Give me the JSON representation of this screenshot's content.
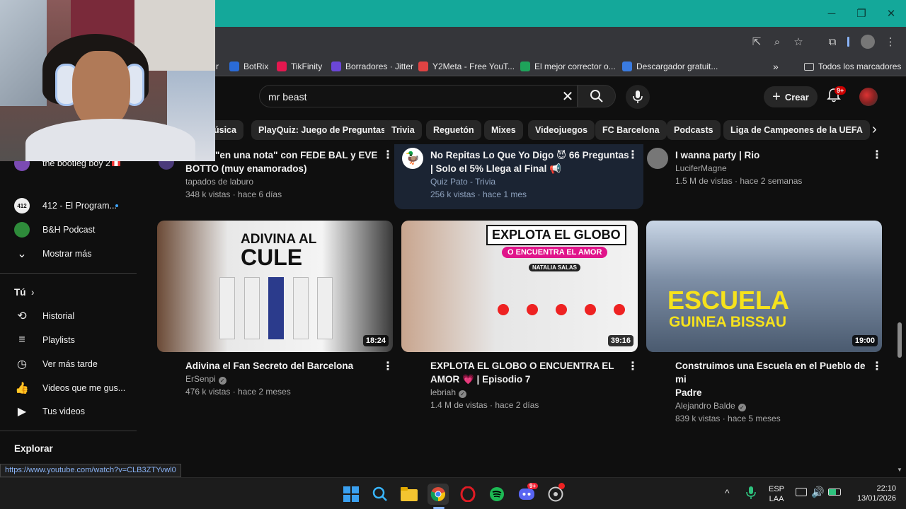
{
  "browser": {
    "bookmarks": [
      {
        "label": "r"
      },
      {
        "label": "BotRix",
        "color": "#2a6bd8"
      },
      {
        "label": "TikFinity",
        "color": "#e5174f"
      },
      {
        "label": "Borradores · Jitter",
        "color": "#6b46d8"
      },
      {
        "label": "Y2Meta - Free YouT...",
        "color": "#e04343"
      },
      {
        "label": "El mejor corrector o...",
        "color": "#1ea35a"
      },
      {
        "label": "Descargador gratuit...",
        "color": "#3a7be0"
      }
    ],
    "all_bookmarks": "Todos los marcadores",
    "status_url": "https://www.youtube.com/watch?v=CLB3ZTYvwl0"
  },
  "youtube": {
    "search": {
      "value": "mr beast"
    },
    "create_label": "Crear",
    "notif_badge": "9+",
    "chips": [
      "Música",
      "PlayQuiz: Juego de Preguntas",
      "Trivia",
      "Reguetón",
      "Mixes",
      "Videojuegos",
      "FC Barcelona",
      "Podcasts",
      "Liga de Campeones de la UEFA"
    ],
    "chips_first_visible": "úsica",
    "sidebar": {
      "subscriptions": [
        {
          "label": "the bootleg boy 2",
          "icon": "avatar-bootleg"
        },
        {
          "label": "412 - El Program...",
          "icon": "avatar-412"
        },
        {
          "label": "B&H Podcast",
          "icon": "avatar-bh"
        }
      ],
      "show_more": "Mostrar más",
      "you_heading": "Tú",
      "you_items": [
        {
          "label": "Historial",
          "icon": "history-icon"
        },
        {
          "label": "Playlists",
          "icon": "playlist-icon"
        },
        {
          "label": "Ver más tarde",
          "icon": "clock-icon"
        },
        {
          "label": "Videos que me gus...",
          "icon": "thumbs-up-icon"
        },
        {
          "label": "Tus videos",
          "icon": "video-icon"
        }
      ],
      "explore_heading": "Explorar"
    },
    "top_row": [
      {
        "title_line1": "...os a \"en una nota\" con FEDE BAL y EVE",
        "title_line2": "BOTTO (muy enamorados)",
        "channel": "tapados de laburo",
        "stats": "348 k vistas · hace 6 días"
      },
      {
        "title_line1": "No Repitas Lo Que Yo Digo 😈 66 Preguntas",
        "title_line2": "| Solo el 5% Llega al Final 📢",
        "channel": "Quiz Pato - Trivia",
        "stats": "256 k vistas · hace 1 mes"
      },
      {
        "title_line1": "I wanna party | Rio",
        "title_line2": "",
        "channel": "LuciferMagne",
        "stats": "1.5 M de vistas · hace 2 semanas"
      }
    ],
    "videos": [
      {
        "title_line1": "Adivina el Fan Secreto del Barcelona",
        "title_line2": "",
        "channel": "ErSenpi",
        "stats": "476 k vistas · hace 2 meses",
        "duration": "18:24",
        "thumb_text1": "ADIVINA AL",
        "thumb_text2": "CULE"
      },
      {
        "title_line1": "EXPLOTA EL GLOBO O ENCUENTRA EL",
        "title_line2": "AMOR 💗 | Episodio 7",
        "channel": "lebriah",
        "stats": "1.4 M de vistas · hace 2 días",
        "duration": "39:16",
        "thumb_text1": "EXPLOTA EL GLOBO",
        "thumb_text2": "O ENCUENTRA EL AMOR",
        "thumb_text3": "NATALIA SALAS"
      },
      {
        "title_line1": "Construimos una Escuela en el Pueblo de mi",
        "title_line2": "Padre",
        "channel": "Alejandro Balde",
        "stats": "839 k vistas · hace 5 meses",
        "duration": "19:00",
        "thumb_text1": "ESCUELA",
        "thumb_text2": "GUINEA BISSAU"
      }
    ]
  },
  "taskbar": {
    "lang_line1": "ESP",
    "lang_line2": "LAA",
    "time": "22:10",
    "date": "13/01/2026",
    "discord_badge": "9+"
  }
}
